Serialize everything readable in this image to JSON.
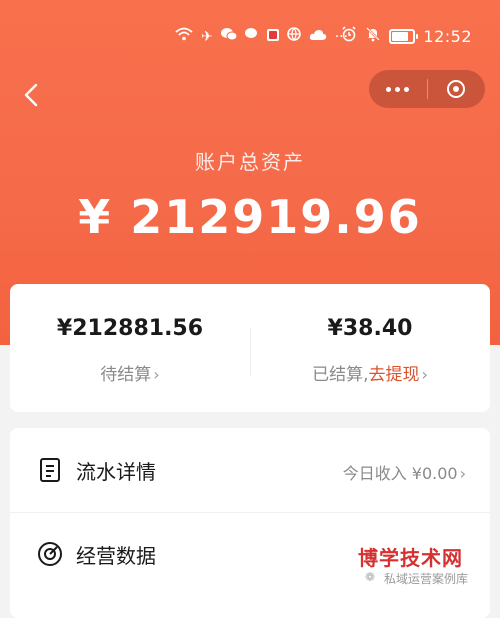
{
  "status_bar": {
    "time": "12:52",
    "icons_left": [
      "wifi-icon",
      "airplane-icon",
      "wechat-icon",
      "wechat-icon-2",
      "red-app-icon",
      "globe-icon",
      "cloud-icon",
      "more-icon"
    ],
    "icons_right": [
      "alarm-icon",
      "mute-icon",
      "battery-icon"
    ],
    "battery_level": 0.9,
    "more": "···"
  },
  "header": {
    "back_icon": "chevron-left-icon",
    "capsule": {
      "more_icon": "more-dots-icon",
      "close_icon": "target-icon"
    }
  },
  "assets": {
    "label": "账户总资产",
    "amount": "¥ 212919.96"
  },
  "settlement": {
    "pending": {
      "amount": "¥212881.56",
      "label": "待结算"
    },
    "settled": {
      "amount": "¥38.40",
      "label": "已结算,",
      "link": "去提现"
    }
  },
  "list": [
    {
      "icon": "document-icon",
      "title": "流水详情",
      "right": "今日收入 ¥0.00"
    },
    {
      "icon": "gauge-icon",
      "title": "经营数据",
      "right": ""
    }
  ],
  "watermark": {
    "logo": "博学技术网",
    "sub": "私域运营案例库"
  },
  "colors": {
    "accent": "#f56b4a",
    "link": "#d9542f",
    "text": "#1a1a1a",
    "muted": "#8a8a8a"
  }
}
